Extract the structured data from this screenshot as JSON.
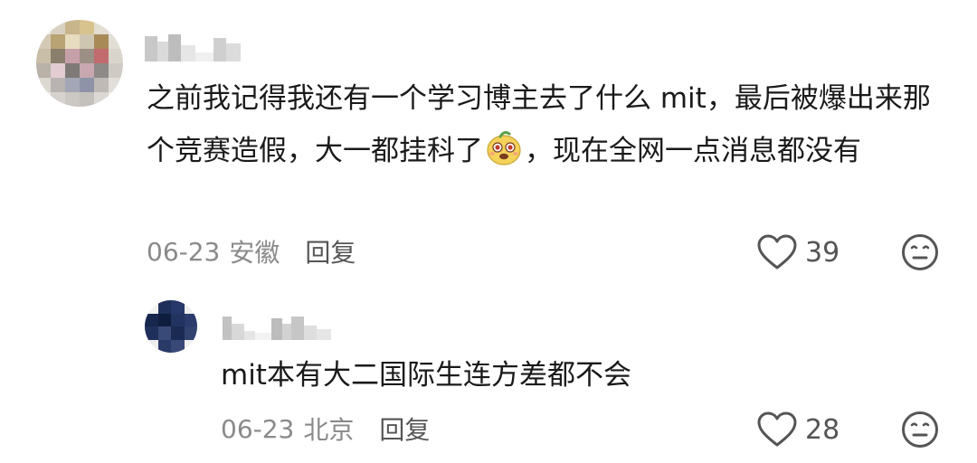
{
  "comments": [
    {
      "text_before_emoji": "之前我记得我还有一个学习博主去了什么 mit，最后被爆出来那个竞赛造假，大一都挂科了",
      "text_after_emoji": "，现在全网一点消息都没有",
      "inline_emoji": "face-emoji-icon",
      "date": "06-23",
      "location": "安徽",
      "reply_label": "回复",
      "likes": "39"
    }
  ],
  "replies": [
    {
      "text": "mit本有大二国际生连方差都不会",
      "date": "06-23",
      "location": "北京",
      "reply_label": "回复",
      "likes": "28"
    }
  ],
  "icons": {
    "like": "heart-outline-icon",
    "reaction": "neutral-face-icon"
  },
  "colors": {
    "text": "#1a1a1a",
    "meta": "#8a8a8a",
    "icon": "#555555",
    "background": "#ffffff"
  }
}
